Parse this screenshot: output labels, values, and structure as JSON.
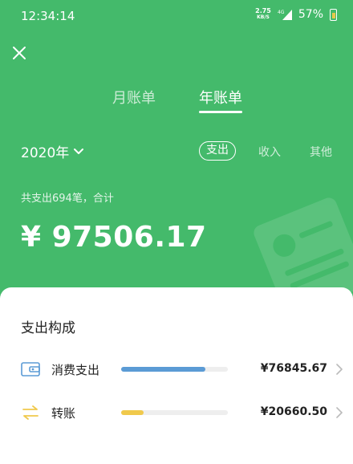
{
  "status_bar": {
    "time": "12:34:14",
    "net_speed_value": "2.75",
    "net_speed_unit": "KB/S",
    "network": "4G",
    "battery": "57%"
  },
  "tabs": [
    {
      "label": "月账单",
      "active": false
    },
    {
      "label": "年账单",
      "active": true
    }
  ],
  "year": "2020年",
  "filters": [
    {
      "label": "支出",
      "active": true
    },
    {
      "label": "收入",
      "active": false
    },
    {
      "label": "其他",
      "active": false
    }
  ],
  "summary": "共支出694笔，合计",
  "total": "¥ 97506.17",
  "section_title": "支出构成",
  "items": [
    {
      "label": "消费支出",
      "value": "¥76845.67",
      "share": 0.788,
      "color": "#5b9bd5",
      "icon": "wallet-icon"
    },
    {
      "label": "转账",
      "value": "¥20660.50",
      "share": 0.212,
      "color": "#f0c94c",
      "icon": "transfer-icon"
    }
  ],
  "colors": {
    "header_green": "#44ba6b",
    "bar_track": "#eeeeee"
  }
}
